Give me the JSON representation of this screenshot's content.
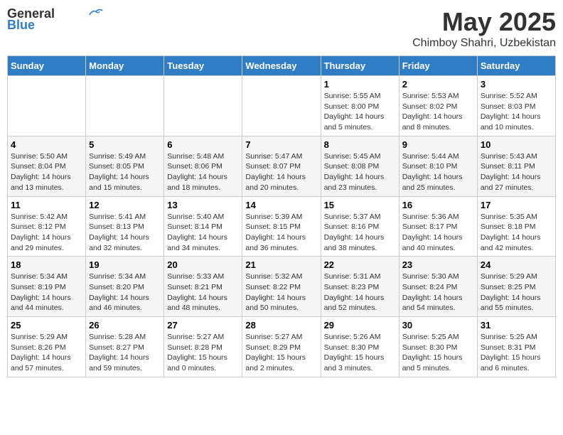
{
  "header": {
    "logo_line1": "General",
    "logo_line2": "Blue",
    "title": "May 2025",
    "subtitle": "Chimboy Shahri, Uzbekistan"
  },
  "days_of_week": [
    "Sunday",
    "Monday",
    "Tuesday",
    "Wednesday",
    "Thursday",
    "Friday",
    "Saturday"
  ],
  "weeks": [
    [
      {
        "day": "",
        "info": ""
      },
      {
        "day": "",
        "info": ""
      },
      {
        "day": "",
        "info": ""
      },
      {
        "day": "",
        "info": ""
      },
      {
        "day": "1",
        "info": "Sunrise: 5:55 AM\nSunset: 8:00 PM\nDaylight: 14 hours\nand 5 minutes."
      },
      {
        "day": "2",
        "info": "Sunrise: 5:53 AM\nSunset: 8:02 PM\nDaylight: 14 hours\nand 8 minutes."
      },
      {
        "day": "3",
        "info": "Sunrise: 5:52 AM\nSunset: 8:03 PM\nDaylight: 14 hours\nand 10 minutes."
      }
    ],
    [
      {
        "day": "4",
        "info": "Sunrise: 5:50 AM\nSunset: 8:04 PM\nDaylight: 14 hours\nand 13 minutes."
      },
      {
        "day": "5",
        "info": "Sunrise: 5:49 AM\nSunset: 8:05 PM\nDaylight: 14 hours\nand 15 minutes."
      },
      {
        "day": "6",
        "info": "Sunrise: 5:48 AM\nSunset: 8:06 PM\nDaylight: 14 hours\nand 18 minutes."
      },
      {
        "day": "7",
        "info": "Sunrise: 5:47 AM\nSunset: 8:07 PM\nDaylight: 14 hours\nand 20 minutes."
      },
      {
        "day": "8",
        "info": "Sunrise: 5:45 AM\nSunset: 8:08 PM\nDaylight: 14 hours\nand 23 minutes."
      },
      {
        "day": "9",
        "info": "Sunrise: 5:44 AM\nSunset: 8:10 PM\nDaylight: 14 hours\nand 25 minutes."
      },
      {
        "day": "10",
        "info": "Sunrise: 5:43 AM\nSunset: 8:11 PM\nDaylight: 14 hours\nand 27 minutes."
      }
    ],
    [
      {
        "day": "11",
        "info": "Sunrise: 5:42 AM\nSunset: 8:12 PM\nDaylight: 14 hours\nand 29 minutes."
      },
      {
        "day": "12",
        "info": "Sunrise: 5:41 AM\nSunset: 8:13 PM\nDaylight: 14 hours\nand 32 minutes."
      },
      {
        "day": "13",
        "info": "Sunrise: 5:40 AM\nSunset: 8:14 PM\nDaylight: 14 hours\nand 34 minutes."
      },
      {
        "day": "14",
        "info": "Sunrise: 5:39 AM\nSunset: 8:15 PM\nDaylight: 14 hours\nand 36 minutes."
      },
      {
        "day": "15",
        "info": "Sunrise: 5:37 AM\nSunset: 8:16 PM\nDaylight: 14 hours\nand 38 minutes."
      },
      {
        "day": "16",
        "info": "Sunrise: 5:36 AM\nSunset: 8:17 PM\nDaylight: 14 hours\nand 40 minutes."
      },
      {
        "day": "17",
        "info": "Sunrise: 5:35 AM\nSunset: 8:18 PM\nDaylight: 14 hours\nand 42 minutes."
      }
    ],
    [
      {
        "day": "18",
        "info": "Sunrise: 5:34 AM\nSunset: 8:19 PM\nDaylight: 14 hours\nand 44 minutes."
      },
      {
        "day": "19",
        "info": "Sunrise: 5:34 AM\nSunset: 8:20 PM\nDaylight: 14 hours\nand 46 minutes."
      },
      {
        "day": "20",
        "info": "Sunrise: 5:33 AM\nSunset: 8:21 PM\nDaylight: 14 hours\nand 48 minutes."
      },
      {
        "day": "21",
        "info": "Sunrise: 5:32 AM\nSunset: 8:22 PM\nDaylight: 14 hours\nand 50 minutes."
      },
      {
        "day": "22",
        "info": "Sunrise: 5:31 AM\nSunset: 8:23 PM\nDaylight: 14 hours\nand 52 minutes."
      },
      {
        "day": "23",
        "info": "Sunrise: 5:30 AM\nSunset: 8:24 PM\nDaylight: 14 hours\nand 54 minutes."
      },
      {
        "day": "24",
        "info": "Sunrise: 5:29 AM\nSunset: 8:25 PM\nDaylight: 14 hours\nand 55 minutes."
      }
    ],
    [
      {
        "day": "25",
        "info": "Sunrise: 5:29 AM\nSunset: 8:26 PM\nDaylight: 14 hours\nand 57 minutes."
      },
      {
        "day": "26",
        "info": "Sunrise: 5:28 AM\nSunset: 8:27 PM\nDaylight: 14 hours\nand 59 minutes."
      },
      {
        "day": "27",
        "info": "Sunrise: 5:27 AM\nSunset: 8:28 PM\nDaylight: 15 hours\nand 0 minutes."
      },
      {
        "day": "28",
        "info": "Sunrise: 5:27 AM\nSunset: 8:29 PM\nDaylight: 15 hours\nand 2 minutes."
      },
      {
        "day": "29",
        "info": "Sunrise: 5:26 AM\nSunset: 8:30 PM\nDaylight: 15 hours\nand 3 minutes."
      },
      {
        "day": "30",
        "info": "Sunrise: 5:25 AM\nSunset: 8:30 PM\nDaylight: 15 hours\nand 5 minutes."
      },
      {
        "day": "31",
        "info": "Sunrise: 5:25 AM\nSunset: 8:31 PM\nDaylight: 15 hours\nand 6 minutes."
      }
    ]
  ]
}
